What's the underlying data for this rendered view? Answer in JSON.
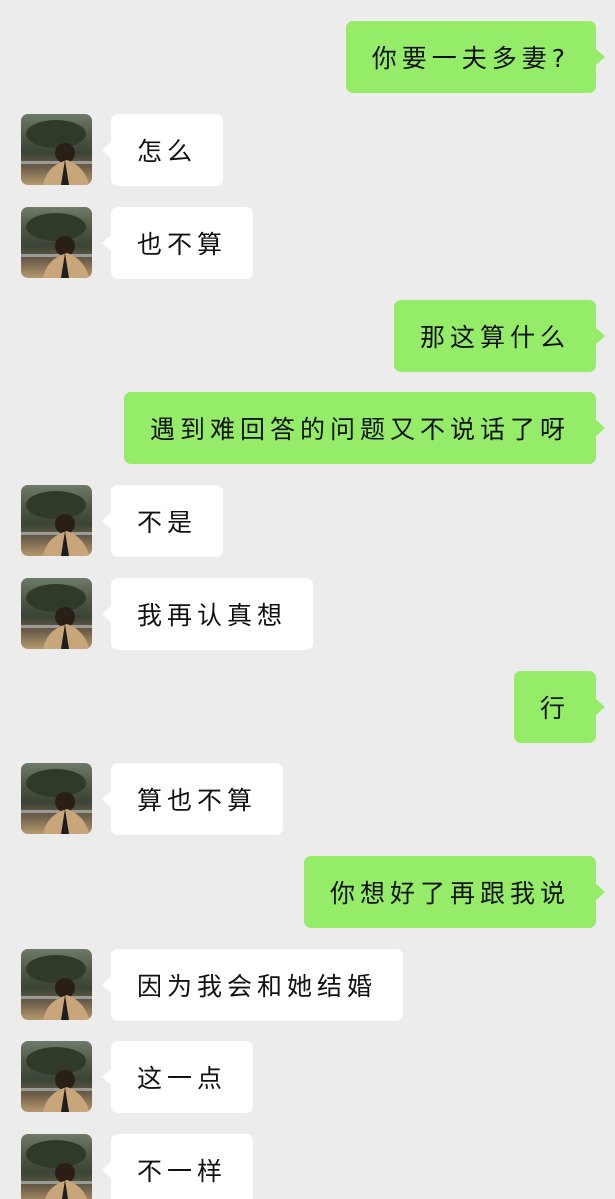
{
  "chat": {
    "messages": [
      {
        "side": "sent",
        "text": "你要一夫多妻?"
      },
      {
        "side": "received",
        "text": "怎么"
      },
      {
        "side": "received",
        "text": "也不算"
      },
      {
        "side": "sent",
        "text": "那这算什么"
      },
      {
        "side": "sent",
        "text": "遇到难回答的问题又不说话了呀"
      },
      {
        "side": "received",
        "text": "不是"
      },
      {
        "side": "received",
        "text": "我再认真想"
      },
      {
        "side": "sent",
        "text": "行"
      },
      {
        "side": "received",
        "text": "算也不算"
      },
      {
        "side": "sent",
        "text": "你想好了再跟我说"
      },
      {
        "side": "received",
        "text": "因为我会和她结婚"
      },
      {
        "side": "received",
        "text": "这一点"
      },
      {
        "side": "received",
        "text": "不一样"
      }
    ]
  },
  "colors": {
    "background": "#ececec",
    "sent_bubble": "#95ec69",
    "received_bubble": "#ffffff"
  },
  "icons": {
    "avatar": "contact-avatar-photo"
  }
}
